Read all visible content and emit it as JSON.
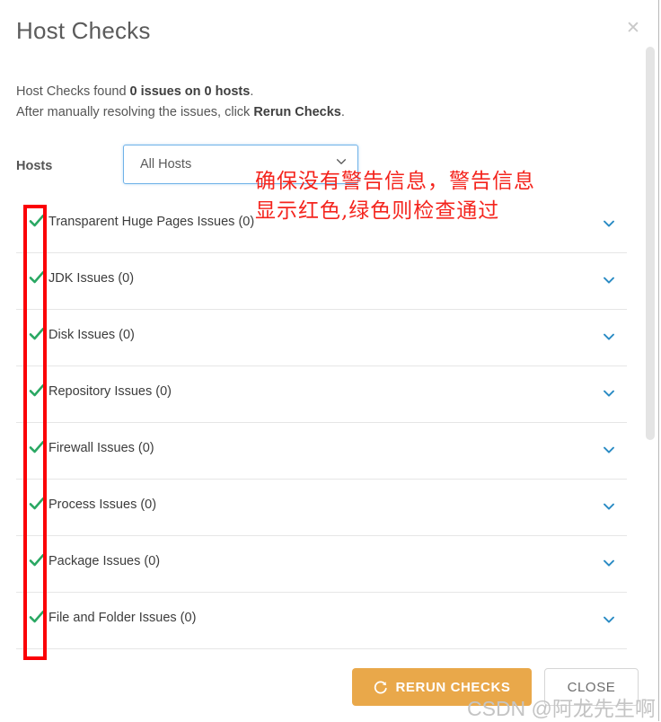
{
  "dialog": {
    "title": "Host Checks",
    "close_icon": "close-x-icon",
    "summary": {
      "line1_pre": "Host Checks found ",
      "line1_bold": "0 issues on 0 hosts",
      "line1_post": ".",
      "line2_pre": "After manually resolving the issues, click ",
      "line2_bold": "Rerun Checks",
      "line2_post": "."
    }
  },
  "hosts_filter": {
    "label": "Hosts",
    "selected": "All Hosts",
    "placeholder": "All Hosts",
    "caret_icon": "chevron-down-icon",
    "options": [
      "All Hosts"
    ]
  },
  "checks": {
    "status_icon": "green-check-icon",
    "expand_icon": "chevron-down-icon",
    "rows": [
      {
        "label": "Transparent Huge Pages Issues (0)",
        "count": 0,
        "status": "pass"
      },
      {
        "label": "JDK Issues (0)",
        "count": 0,
        "status": "pass"
      },
      {
        "label": "Disk Issues (0)",
        "count": 0,
        "status": "pass"
      },
      {
        "label": "Repository Issues (0)",
        "count": 0,
        "status": "pass"
      },
      {
        "label": "Firewall Issues (0)",
        "count": 0,
        "status": "pass"
      },
      {
        "label": "Process Issues (0)",
        "count": 0,
        "status": "pass"
      },
      {
        "label": "Package Issues (0)",
        "count": 0,
        "status": "pass"
      },
      {
        "label": "File and Folder Issues (0)",
        "count": 0,
        "status": "pass"
      }
    ]
  },
  "footer": {
    "rerun_label": "RERUN CHECKS",
    "rerun_icon": "refresh-icon",
    "close_label": "CLOSE"
  },
  "annotations": {
    "red_box_label": "red-highlight-box",
    "note_line1": "确保没有警告信息，警告信息",
    "note_line2": "显示红色,绿色则检查通过",
    "watermark": "CSDN @阿龙先生啊"
  },
  "colors": {
    "accent_orange": "#e9a84a",
    "link_blue": "#2a8bc4",
    "pass_green": "#2aa863",
    "annotation_red": "#f4241d",
    "select_border": "#6fb2e8"
  }
}
